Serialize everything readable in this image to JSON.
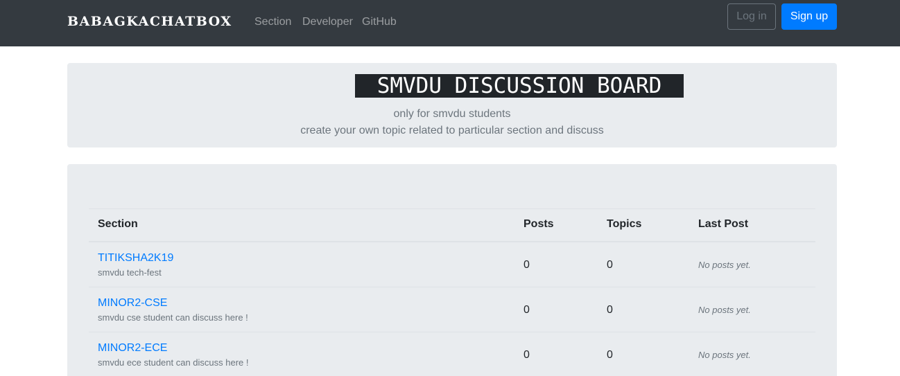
{
  "navbar": {
    "brand": "BABAGKACHATBOX",
    "links": [
      "Section",
      "Developer",
      "GitHub"
    ],
    "login_label": "Log in",
    "signup_label": "Sign up"
  },
  "jumbotron": {
    "title": "SMVDU DISCUSSION BOARD",
    "line1": "only for smvdu students",
    "line2": "create your own topic related to particular section and discuss"
  },
  "table": {
    "headers": [
      "Section",
      "Posts",
      "Topics",
      "Last Post"
    ],
    "rows": [
      {
        "name": "TITIKSHA2K19",
        "desc": "smvdu tech-fest",
        "posts": "0",
        "topics": "0",
        "last": "No posts yet."
      },
      {
        "name": "MINOR2-CSE",
        "desc": "smvdu cse student can discuss here !",
        "posts": "0",
        "topics": "0",
        "last": "No posts yet."
      },
      {
        "name": "MINOR2-ECE",
        "desc": "smvdu ece student can discuss here !",
        "posts": "0",
        "topics": "0",
        "last": "No posts yet."
      }
    ]
  },
  "colors": {
    "navbar_bg": "#343a40",
    "primary": "#007bff",
    "panel_bg": "#e9ecef"
  }
}
